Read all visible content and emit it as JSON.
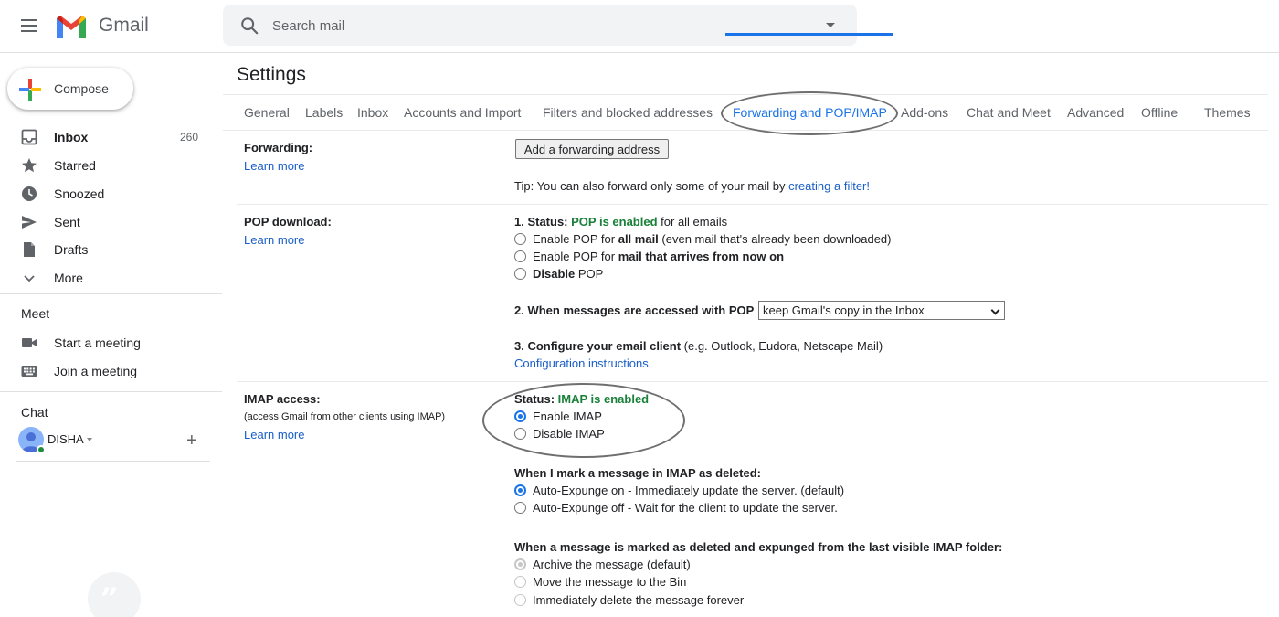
{
  "app": {
    "logo_text": "Gmail"
  },
  "search": {
    "placeholder": "Search mail"
  },
  "compose": {
    "label": "Compose"
  },
  "sidebar": {
    "items": [
      {
        "label": "Inbox",
        "count": "260"
      },
      {
        "label": "Starred"
      },
      {
        "label": "Snoozed"
      },
      {
        "label": "Sent"
      },
      {
        "label": "Drafts"
      },
      {
        "label": "More"
      }
    ],
    "meet": {
      "title": "Meet",
      "start": "Start a meeting",
      "join": "Join a meeting"
    },
    "chat": {
      "title": "Chat",
      "user": "DISHA"
    }
  },
  "settings": {
    "title": "Settings",
    "tabs": [
      "General",
      "Labels",
      "Inbox",
      "Accounts and Import",
      "Filters and blocked addresses",
      "Forwarding and POP/IMAP",
      "Add-ons",
      "Chat and Meet",
      "Advanced",
      "Offline",
      "Themes"
    ],
    "active_tab": "Forwarding and POP/IMAP",
    "forwarding": {
      "label": "Forwarding:",
      "learn_more": "Learn more",
      "button": "Add a forwarding address",
      "tip_prefix": "Tip: You can also forward only some of your mail by ",
      "tip_link": "creating a filter!"
    },
    "pop": {
      "label": "POP download:",
      "learn_more": "Learn more",
      "status_prefix": "1. Status: ",
      "status_value": "POP is enabled",
      "status_suffix": " for all emails",
      "option1_a": "Enable POP for ",
      "option1_b": "all mail",
      "option1_c": " (even mail that's already been downloaded)",
      "option2_a": "Enable POP for ",
      "option2_b": "mail that arrives from now on",
      "option3_a": "Disable",
      "option3_b": " POP",
      "access_label": "2. When messages are accessed with POP",
      "access_select": "keep Gmail's copy in the Inbox",
      "configure_label": "3. Configure your email client",
      "configure_hint": " (e.g. Outlook, Eudora, Netscape Mail)",
      "configure_link": "Configuration instructions"
    },
    "imap": {
      "label": "IMAP access:",
      "sub": "(access Gmail from other clients using IMAP)",
      "learn_more": "Learn more",
      "status_prefix": "Status: ",
      "status_value": "IMAP is enabled",
      "enable": "Enable IMAP",
      "disable": "Disable IMAP",
      "deleted_title": "When I mark a message in IMAP as deleted:",
      "expunge_on": "Auto-Expunge on - Immediately update the server. (default)",
      "expunge_off": "Auto-Expunge off - Wait for the client to update the server.",
      "expunged_title": "When a message is marked as deleted and expunged from the last visible IMAP folder:",
      "archive": "Archive the message (default)",
      "move_bin": "Move the message to the Bin",
      "delete_forever": "Immediately delete the message forever"
    }
  },
  "colors": {
    "accent": "#1a73e8",
    "enabled_green": "#188038",
    "link": "#1a5ec8"
  }
}
